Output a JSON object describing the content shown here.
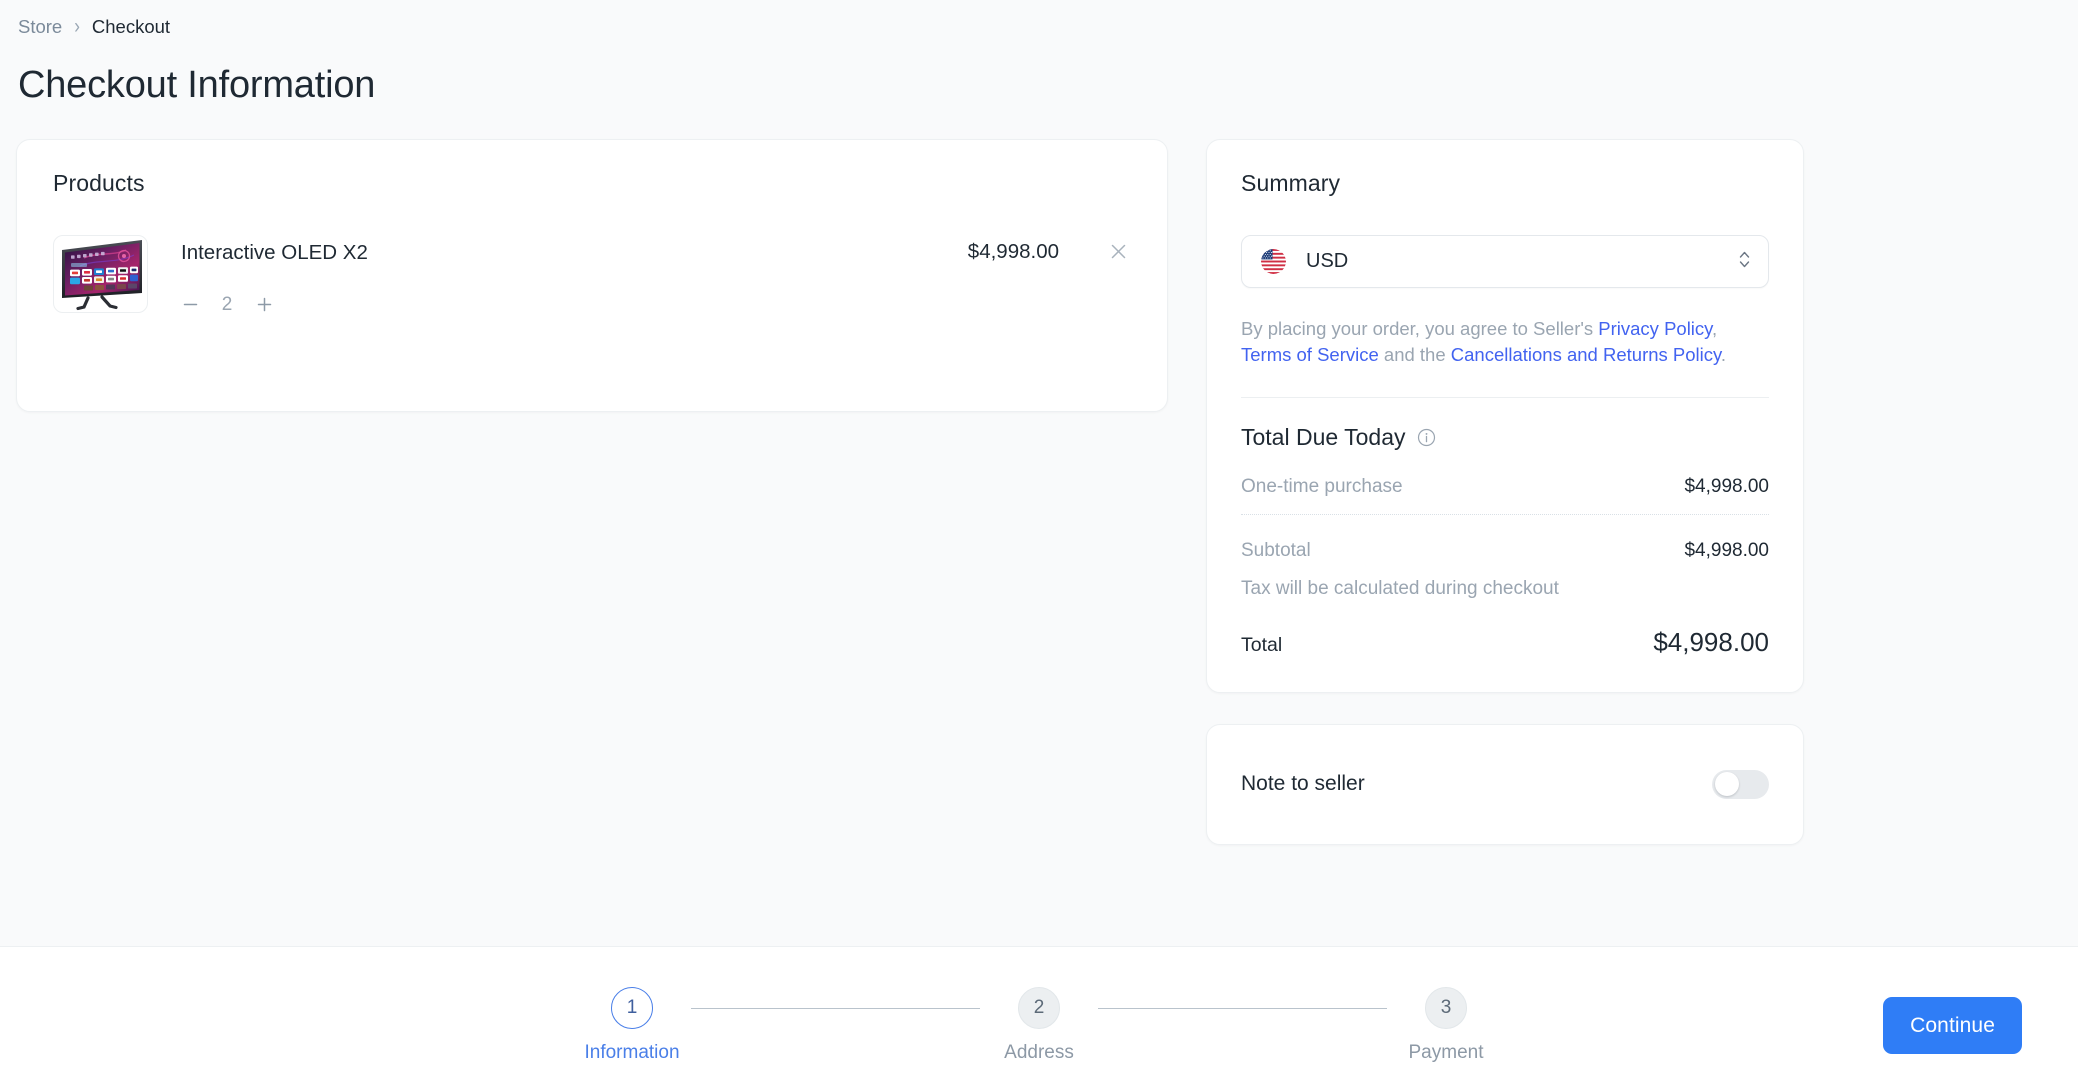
{
  "breadcrumb": {
    "store_label": "Store",
    "separator": "›",
    "current_label": "Checkout"
  },
  "page_title": "Checkout Information",
  "products": {
    "heading": "Products",
    "items": [
      {
        "name": "Interactive OLED X2",
        "price": "$4,998.00",
        "quantity": "2",
        "decrease_label": "−",
        "increase_label": "+"
      }
    ]
  },
  "summary": {
    "heading": "Summary",
    "currency": {
      "code": "USD",
      "flag": "us-flag-icon"
    },
    "legal": {
      "prefix": "By placing your order, you agree to Seller's ",
      "privacy_policy": "Privacy Policy",
      "comma": ", ",
      "terms_of_service": "Terms of Service",
      "middle": " and the ",
      "cancellations_returns": "Cancellations and Returns Policy",
      "suffix": "."
    },
    "totals": {
      "title": "Total Due Today",
      "info_icon": "info-icon",
      "lines": [
        {
          "label": "One-time purchase",
          "value": "$4,998.00"
        },
        {
          "label": "Subtotal",
          "value": "$4,998.00"
        }
      ],
      "tax_note": "Tax will be calculated during checkout",
      "total_label": "Total",
      "total_value": "$4,998.00"
    }
  },
  "note_to_seller": {
    "label": "Note to seller",
    "enabled": false
  },
  "stepper": {
    "steps": [
      {
        "number": "1",
        "label": "Information",
        "active": true
      },
      {
        "number": "2",
        "label": "Address",
        "active": false
      },
      {
        "number": "3",
        "label": "Payment",
        "active": false
      }
    ]
  },
  "footer": {
    "continue_label": "Continue"
  },
  "colors": {
    "accent_blue": "#2f7df6",
    "link_blue": "#4263f0",
    "active_step": "#4a7fe8",
    "page_bg": "#f9fafb",
    "card_bg": "#ffffff",
    "muted_text": "#9aa5b1"
  }
}
